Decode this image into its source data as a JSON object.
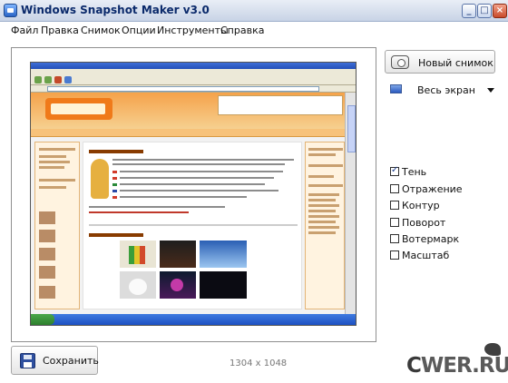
{
  "window": {
    "title": "Windows Snapshot Maker v3.0",
    "minimize": "_",
    "maximize": "□",
    "close": "×"
  },
  "menu": {
    "items": [
      "Файл",
      "Правка",
      "Снимок",
      "Опции",
      "Инструменты",
      "Справка"
    ]
  },
  "panel": {
    "new_snapshot": "Новый снимок",
    "capture_mode": "Весь экран"
  },
  "options": [
    {
      "label": "Тень",
      "checked": true
    },
    {
      "label": "Отражение",
      "checked": false
    },
    {
      "label": "Контур",
      "checked": false
    },
    {
      "label": "Поворот",
      "checked": false
    },
    {
      "label": "Вотермарк",
      "checked": false
    },
    {
      "label": "Масштаб",
      "checked": false
    }
  ],
  "bottom": {
    "save": "Сохранить",
    "dimensions": "1304 x 1048",
    "watermark": "CWER.RU"
  },
  "icons": {
    "app": "app-icon",
    "new_snapshot": "camera-icon",
    "capture_mode": "monitor-icon",
    "dropdown": "chevron-down-icon",
    "save": "floppy-disk-icon"
  }
}
